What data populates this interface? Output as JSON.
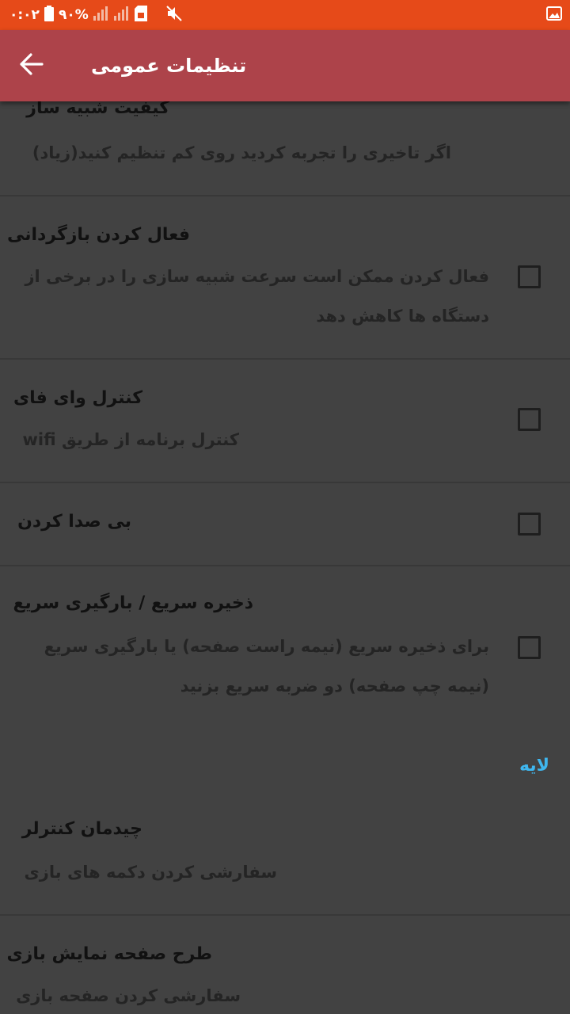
{
  "status_bar": {
    "time": "۰:۰۲",
    "battery": "۹۰%"
  },
  "appbar": {
    "title": "تنظیمات عمومی",
    "back_icon": "arrow-back-icon"
  },
  "prefs": {
    "quality": {
      "title": "کیفیت شبیه ساز",
      "summary": "اگر تاخیری را تجربه کردید روی کم تنظیم کنید(زیاد)"
    },
    "rewind": {
      "title": "فعال کردن بازگردانی",
      "summary": "فعال کردن ممکن است سرعت شبیه سازی را در برخی از دستگاه ها کاهش دهد",
      "checked": false
    },
    "wifi": {
      "title": "کنترل وای فای",
      "summary": "کنترل برنامه از طریق wifi",
      "checked": false
    },
    "mute": {
      "title": "بی صدا کردن",
      "checked": false
    },
    "quicksave": {
      "title": "ذخیره سریع / بارگیری سریع",
      "summary": "برای ذخیره سریع (نیمه راست صفحه) یا بارگیری سریع (نیمه چپ صفحه) دو ضربه سریع بزنید",
      "checked": false
    }
  },
  "section": {
    "layer_label": "لایه"
  },
  "layer_prefs": {
    "controller_layout": {
      "title": "چیدمان کنترلر",
      "summary": "سفارشی کردن دکمه های بازی"
    },
    "screen_layout": {
      "title": "طرح صفحه نمایش بازی",
      "summary": "سفارشی کردن صفحه بازی"
    }
  },
  "colors": {
    "status_bar": "#e64a19",
    "app_bar": "#ad434a",
    "background": "#424242",
    "accent": "#3fb6ee"
  }
}
